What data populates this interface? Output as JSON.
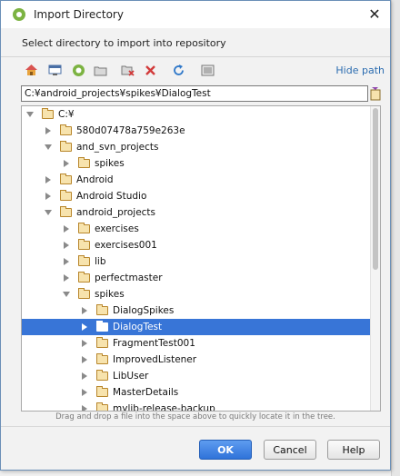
{
  "window": {
    "title": "Import Directory",
    "close_glyph": "✕"
  },
  "subtitle": "Select directory to import into repository",
  "toolbar": {
    "icons": [
      "home-icon",
      "desktop-icon",
      "android-project-icon",
      "new-folder-icon",
      "delete-folder-icon",
      "delete-icon",
      "refresh-icon",
      "show-hidden-icon"
    ],
    "hide_path_label": "Hide path"
  },
  "path": {
    "value": "C:¥android_projects¥spikes¥DialogTest"
  },
  "tree": {
    "rows": [
      {
        "label": "C:¥",
        "expanded": true,
        "selected": false
      },
      {
        "label": "580d07478a759e263e",
        "expanded": false,
        "selected": false
      },
      {
        "label": "and_svn_projects",
        "expanded": true,
        "selected": false
      },
      {
        "label": "spikes",
        "expanded": false,
        "selected": false
      },
      {
        "label": "Android",
        "expanded": false,
        "selected": false
      },
      {
        "label": "Android Studio",
        "expanded": false,
        "selected": false
      },
      {
        "label": "android_projects",
        "expanded": true,
        "selected": false
      },
      {
        "label": "exercises",
        "expanded": false,
        "selected": false
      },
      {
        "label": "exercises001",
        "expanded": false,
        "selected": false
      },
      {
        "label": "lib",
        "expanded": false,
        "selected": false
      },
      {
        "label": "perfectmaster",
        "expanded": false,
        "selected": false
      },
      {
        "label": "spikes",
        "expanded": true,
        "selected": false
      },
      {
        "label": "DialogSpikes",
        "expanded": false,
        "selected": false
      },
      {
        "label": "DialogTest",
        "expanded": false,
        "selected": true
      },
      {
        "label": "FragmentTest001",
        "expanded": false,
        "selected": false
      },
      {
        "label": "ImprovedListener",
        "expanded": false,
        "selected": false
      },
      {
        "label": "LibUser",
        "expanded": false,
        "selected": false
      },
      {
        "label": "MasterDetails",
        "expanded": false,
        "selected": false
      },
      {
        "label": "mylib-release-backup",
        "expanded": false,
        "selected": false
      }
    ]
  },
  "hint": "Drag and drop a file into the space above to quickly locate it in the tree.",
  "buttons": {
    "ok": "OK",
    "cancel": "Cancel",
    "help": "Help"
  },
  "colors": {
    "selection": "#3875d7",
    "link": "#2b6cb0",
    "primary_button": "#2f73d9"
  }
}
